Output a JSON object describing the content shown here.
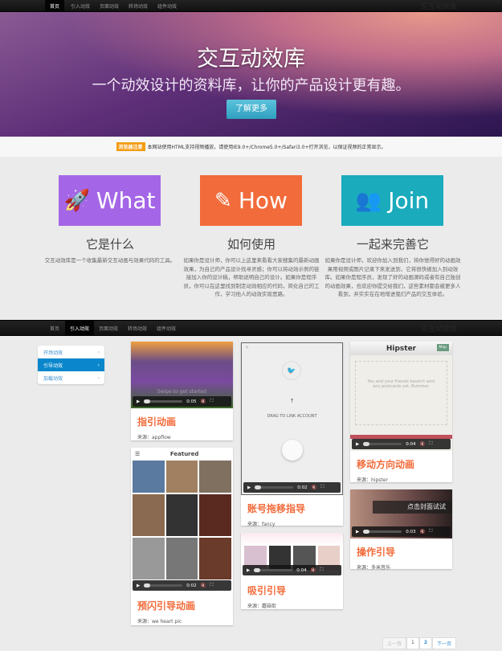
{
  "nav": {
    "items": [
      "首页",
      "引入动效",
      "页面动效",
      "转场动效",
      "组件动效"
    ],
    "brand": "交互动效库"
  },
  "hero": {
    "title": "交互动效库",
    "subtitle": "一个动效设计的资料库，让你的产品设计更有趣。",
    "button": "了解更多"
  },
  "notice": {
    "tag": "浏览器注意",
    "text": "本网站使用HTML支持视频播放，请使用IE9.0+/Chrome5.0+/Safari3.0+打开浏览，以保证视频的正常显示。"
  },
  "features": [
    {
      "tile": "What",
      "color": "#a466e6",
      "heading": "它是什么",
      "text": "交互动效库是一个收集最新交互动画与效果代码的工具。"
    },
    {
      "tile": "How",
      "color": "#f26b3a",
      "heading": "如何使用",
      "text": "如果你是设计师，你可以上这里来看看大家搜集的最新动画效果，为自己的产品设计找寻灵感；你可以将动效示例的链接加入你的设计稿，帮助说明自己的设计。如果你是程序员，你可以在这里找到制定动效相应的代码，简化自己的工作，学习他人的动效实现思路。"
    },
    {
      "tile": "Join",
      "color": "#1aabbd",
      "heading": "一起来完善它",
      "text": "如果你是设计师，欢迎你加入到我们，将你觉得好的动画效果用视频或图片记录下来发送到，它将很快被加入到动效库。如果你是程序员，发现了好的动画源码或者有自己独创的动画效果，也欢迎你提交给我们，这些素材都会被更多人看到，并实实在在地增进我们产品的交互体验。"
    }
  ],
  "sidebar": {
    "items": [
      "开场动效",
      "引导动效",
      "加载动效"
    ]
  },
  "cards": [
    {
      "title": "指引动画",
      "source": "来源：appflow",
      "time": "0:05",
      "overlay": "Swipe to get started"
    },
    {
      "title": "预闪引导动画",
      "source": "来源：we heart pic",
      "time": "0:02",
      "overlay": "Featured"
    },
    {
      "title": "账号拖移指导",
      "source": "来源：fancy",
      "time": "0:02",
      "overlay": "DRAG TO LINK ACCOUNT"
    },
    {
      "title": "吸引引导",
      "source": "来源：蘑菇街",
      "time": "0:04"
    },
    {
      "title": "移动方向动画",
      "source": "来源：hipster",
      "time": "0:04",
      "overlay": "Hipster",
      "map": "Map",
      "msg": "You and your friends haven't sent any postcards yet. Bummer."
    },
    {
      "title": "操作引导",
      "source": "来源：多米音乐",
      "time": "0:03",
      "overlay": "点击封面试试"
    }
  ],
  "pager": {
    "prev": "上一页",
    "pages": [
      "1",
      "2"
    ],
    "next": "下一页"
  }
}
